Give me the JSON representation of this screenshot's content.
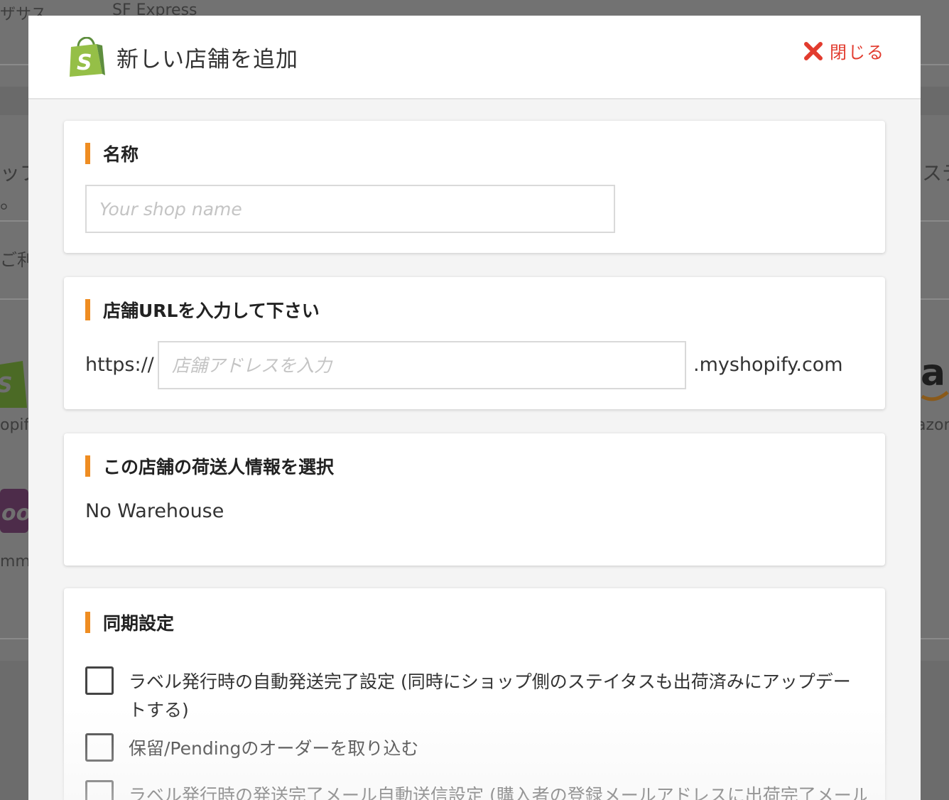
{
  "background": {
    "carrier_label": "SF Express",
    "left_fragments": [
      "ザサス",
      "ップ",
      "。",
      "ご利",
      "opify",
      "mm"
    ],
    "right_fragments": [
      "ステ",
      "azon"
    ]
  },
  "modal": {
    "title": "新しい店舗を追加",
    "close_label": "閉じる",
    "icons": {
      "logo": "shopify-bag-icon",
      "close": "close-x-icon"
    },
    "colors": {
      "accent": "#ef8d22",
      "close": "#e23b2e",
      "shopify_green": "#95bf47"
    }
  },
  "name_section": {
    "title": "名称",
    "input_value": "",
    "placeholder": "Your shop name"
  },
  "url_section": {
    "title": "店舗URLを入力して下さい",
    "prefix": "https://",
    "input_value": "",
    "placeholder": "店舗アドレスを入力",
    "suffix": ".myshopify.com"
  },
  "sender_section": {
    "title": "この店舗の荷送人情報を選択",
    "value": "No Warehouse"
  },
  "sync_section": {
    "title": "同期設定",
    "options": [
      {
        "label": "ラベル発行時の自動発送完了設定 (同時にショップ側のステイタスも出荷済みにアップデートする)",
        "checked": false
      },
      {
        "label": "保留/Pendingのオーダーを取り込む",
        "checked": false
      },
      {
        "label": "ラベル発行時の発送完了メール自動送信設定 (購入者の登録メールアドレスに出荷完了メール",
        "checked": false
      }
    ]
  }
}
